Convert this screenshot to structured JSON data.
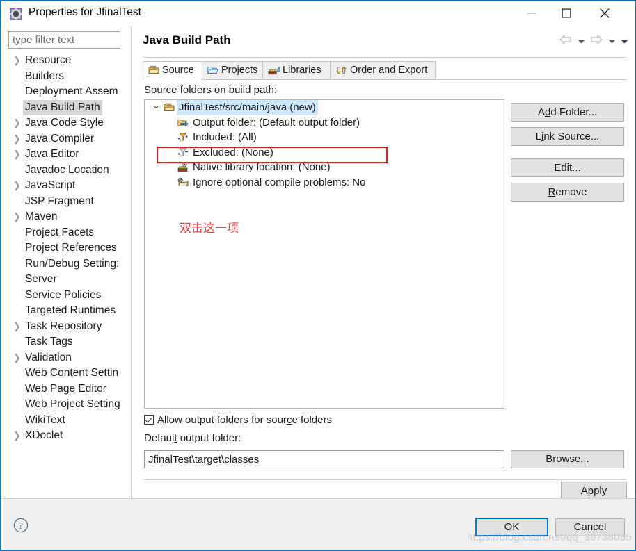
{
  "window": {
    "title": "Properties for JfinalTest",
    "icon": "properties-gear-icon",
    "controls": {
      "minimize": "minimize-icon",
      "maximize": "maximize-icon",
      "close": "close-icon"
    }
  },
  "sidebar": {
    "filter_placeholder": "type filter text",
    "filter_value": "",
    "items": [
      {
        "label": "Resource",
        "expandable": true,
        "selected": false
      },
      {
        "label": "Builders",
        "expandable": false,
        "selected": false
      },
      {
        "label": "Deployment Assem",
        "expandable": false,
        "selected": false
      },
      {
        "label": "Java Build Path",
        "expandable": false,
        "selected": true
      },
      {
        "label": "Java Code Style",
        "expandable": true,
        "selected": false
      },
      {
        "label": "Java Compiler",
        "expandable": true,
        "selected": false
      },
      {
        "label": "Java Editor",
        "expandable": true,
        "selected": false
      },
      {
        "label": "Javadoc Location",
        "expandable": false,
        "selected": false
      },
      {
        "label": "JavaScript",
        "expandable": true,
        "selected": false
      },
      {
        "label": "JSP Fragment",
        "expandable": false,
        "selected": false
      },
      {
        "label": "Maven",
        "expandable": true,
        "selected": false
      },
      {
        "label": "Project Facets",
        "expandable": false,
        "selected": false
      },
      {
        "label": "Project References",
        "expandable": false,
        "selected": false
      },
      {
        "label": "Run/Debug Setting:",
        "expandable": false,
        "selected": false
      },
      {
        "label": "Server",
        "expandable": false,
        "selected": false
      },
      {
        "label": "Service Policies",
        "expandable": false,
        "selected": false
      },
      {
        "label": "Targeted Runtimes",
        "expandable": false,
        "selected": false
      },
      {
        "label": "Task Repository",
        "expandable": true,
        "selected": false
      },
      {
        "label": "Task Tags",
        "expandable": false,
        "selected": false
      },
      {
        "label": "Validation",
        "expandable": true,
        "selected": false
      },
      {
        "label": "Web Content Settin",
        "expandable": false,
        "selected": false
      },
      {
        "label": "Web Page Editor",
        "expandable": false,
        "selected": false
      },
      {
        "label": "Web Project Setting",
        "expandable": false,
        "selected": false
      },
      {
        "label": "WikiText",
        "expandable": false,
        "selected": false
      },
      {
        "label": "XDoclet",
        "expandable": true,
        "selected": false
      }
    ],
    "scrollbar": {
      "left_arrow": "chevron-left-icon",
      "right_arrow": "chevron-right-icon"
    }
  },
  "page": {
    "title": "Java Build Path",
    "nav": {
      "back": "back-arrow-icon",
      "back_menu": "chevron-down-icon",
      "forward": "forward-arrow-icon",
      "forward_menu": "chevron-down-icon",
      "more_menu": "chevron-down-filled-icon"
    },
    "tabs": [
      {
        "label": "Source",
        "icon": "source-folder-icon",
        "active": true
      },
      {
        "label": "Projects",
        "icon": "project-folder-icon",
        "active": false
      },
      {
        "label": "Libraries",
        "icon": "library-books-icon",
        "active": false
      },
      {
        "label": "Order and Export",
        "icon": "order-export-icon",
        "active": false
      }
    ],
    "content_label": "Source folders on build path:",
    "tree": [
      {
        "label": "JfinalTest/src/main/java (new)",
        "icon": "source-folder-icon",
        "level": 0,
        "twisty": "expanded",
        "selected": true
      },
      {
        "label": "Output folder: (Default output folder)",
        "icon": "output-folder-icon",
        "level": 1,
        "twisty": "",
        "selected": false
      },
      {
        "label": "Included: (All)",
        "icon": "included-filter-icon",
        "level": 1,
        "twisty": "",
        "selected": false
      },
      {
        "label": "Excluded: (None)",
        "icon": "excluded-filter-icon",
        "level": 1,
        "twisty": "",
        "selected": false
      },
      {
        "label": "Native library location: (None)",
        "icon": "native-library-icon",
        "level": 1,
        "twisty": "",
        "selected": false
      },
      {
        "label": "Ignore optional compile problems: No",
        "icon": "ignore-problems-icon",
        "level": 1,
        "twisty": "",
        "selected": false
      }
    ],
    "annotation": {
      "text": "双击这一项",
      "box_color": "#ef1b1b",
      "text_color": "#ef4040"
    },
    "side_buttons": [
      {
        "id": "add-folder",
        "label": "Add Folder...",
        "mnemonic": "d"
      },
      {
        "id": "link-source",
        "label": "Link Source...",
        "mnemonic": "i"
      },
      {
        "id": "edit",
        "label": "Edit...",
        "mnemonic": "E"
      },
      {
        "id": "remove",
        "label": "Remove",
        "mnemonic": "R"
      }
    ],
    "allow_output_folders": {
      "label": "Allow output folders for source folders",
      "checked": true
    },
    "default_output": {
      "label": "Default output folder:",
      "value": "JfinalTest\\target\\classes",
      "browse_label": "Browse..."
    },
    "apply_label": "Apply"
  },
  "footer": {
    "help_icon": "help-question-icon",
    "ok_label": "OK",
    "cancel_label": "Cancel"
  },
  "watermark": "https://blog.csdn.net/qq_39738055",
  "colors": {
    "accent": "#0078d7",
    "selection": "#cde8ff",
    "nav_selection": "#d6d6d6",
    "button_face": "#e1e1e1",
    "annotation_red": "#ef1b1b"
  }
}
